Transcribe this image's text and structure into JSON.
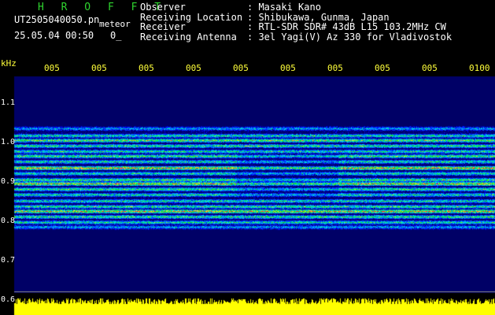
{
  "header": {
    "brand": "H R O F F T",
    "filename": "UT2505040050.pn",
    "tag": "meteor",
    "datetime": "25.05.04 00:50",
    "counter": "0_"
  },
  "station_info": [
    {
      "key": "Observer",
      "value": ": Masaki Kano"
    },
    {
      "key": "Receiving Location",
      "value": ": Shibukawa, Gunma, Japan"
    },
    {
      "key": "Receiver",
      "value": ": RTL-SDR SDR# 43dB L15 103.2MHz CW"
    },
    {
      "key": "Receiving Antenna",
      "value": ": 3el Yagi(V) Az 330 for Vladivostok"
    }
  ],
  "axes": {
    "y_unit": "kHz",
    "y_ticks": [
      "1.1",
      "1.0",
      "0.9",
      "0.8",
      "0.7",
      "0.6"
    ],
    "x_ticks": [
      "005",
      "005",
      "005",
      "005",
      "005",
      "005",
      "005",
      "005",
      "005",
      "0100"
    ]
  },
  "colors": {
    "brand": "#2fd42f",
    "axis": "#ffff3a",
    "background": "#000000",
    "noise_floor": "#000066",
    "amplitude_trace": "#ffff00"
  }
}
